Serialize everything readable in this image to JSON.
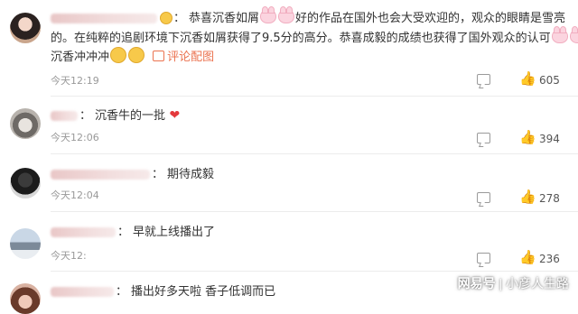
{
  "comments": [
    {
      "line1_a": "恭喜沉香如屑",
      "line1_b": "好的作品在国外也会大受欢迎的，观众的眼睛是雪亮",
      "line2": "的。在纯粹的追剧环境下沉香如屑获得了9.5分的高分。恭喜成毅的成绩也获得了国外观众的认可",
      "line3_text": "沉香冲冲冲",
      "picture_link": "评论配图",
      "time": "今天12:19",
      "likes": "605"
    },
    {
      "text": "沉香牛的一批",
      "time": "今天12:06",
      "likes": "394"
    },
    {
      "text": "期待成毅",
      "time": "今天12:04",
      "likes": "278"
    },
    {
      "text": "早就上线播出了",
      "time": "今天12:",
      "likes": "236"
    },
    {
      "text": "播出好多天啦 香子低调而已"
    }
  ],
  "watermark": {
    "logo": "网易号",
    "separator": "|",
    "account": "小彦人生路"
  },
  "colors": {
    "link": "#eb7350",
    "meta": "#999999",
    "heart": "#e4393c"
  }
}
